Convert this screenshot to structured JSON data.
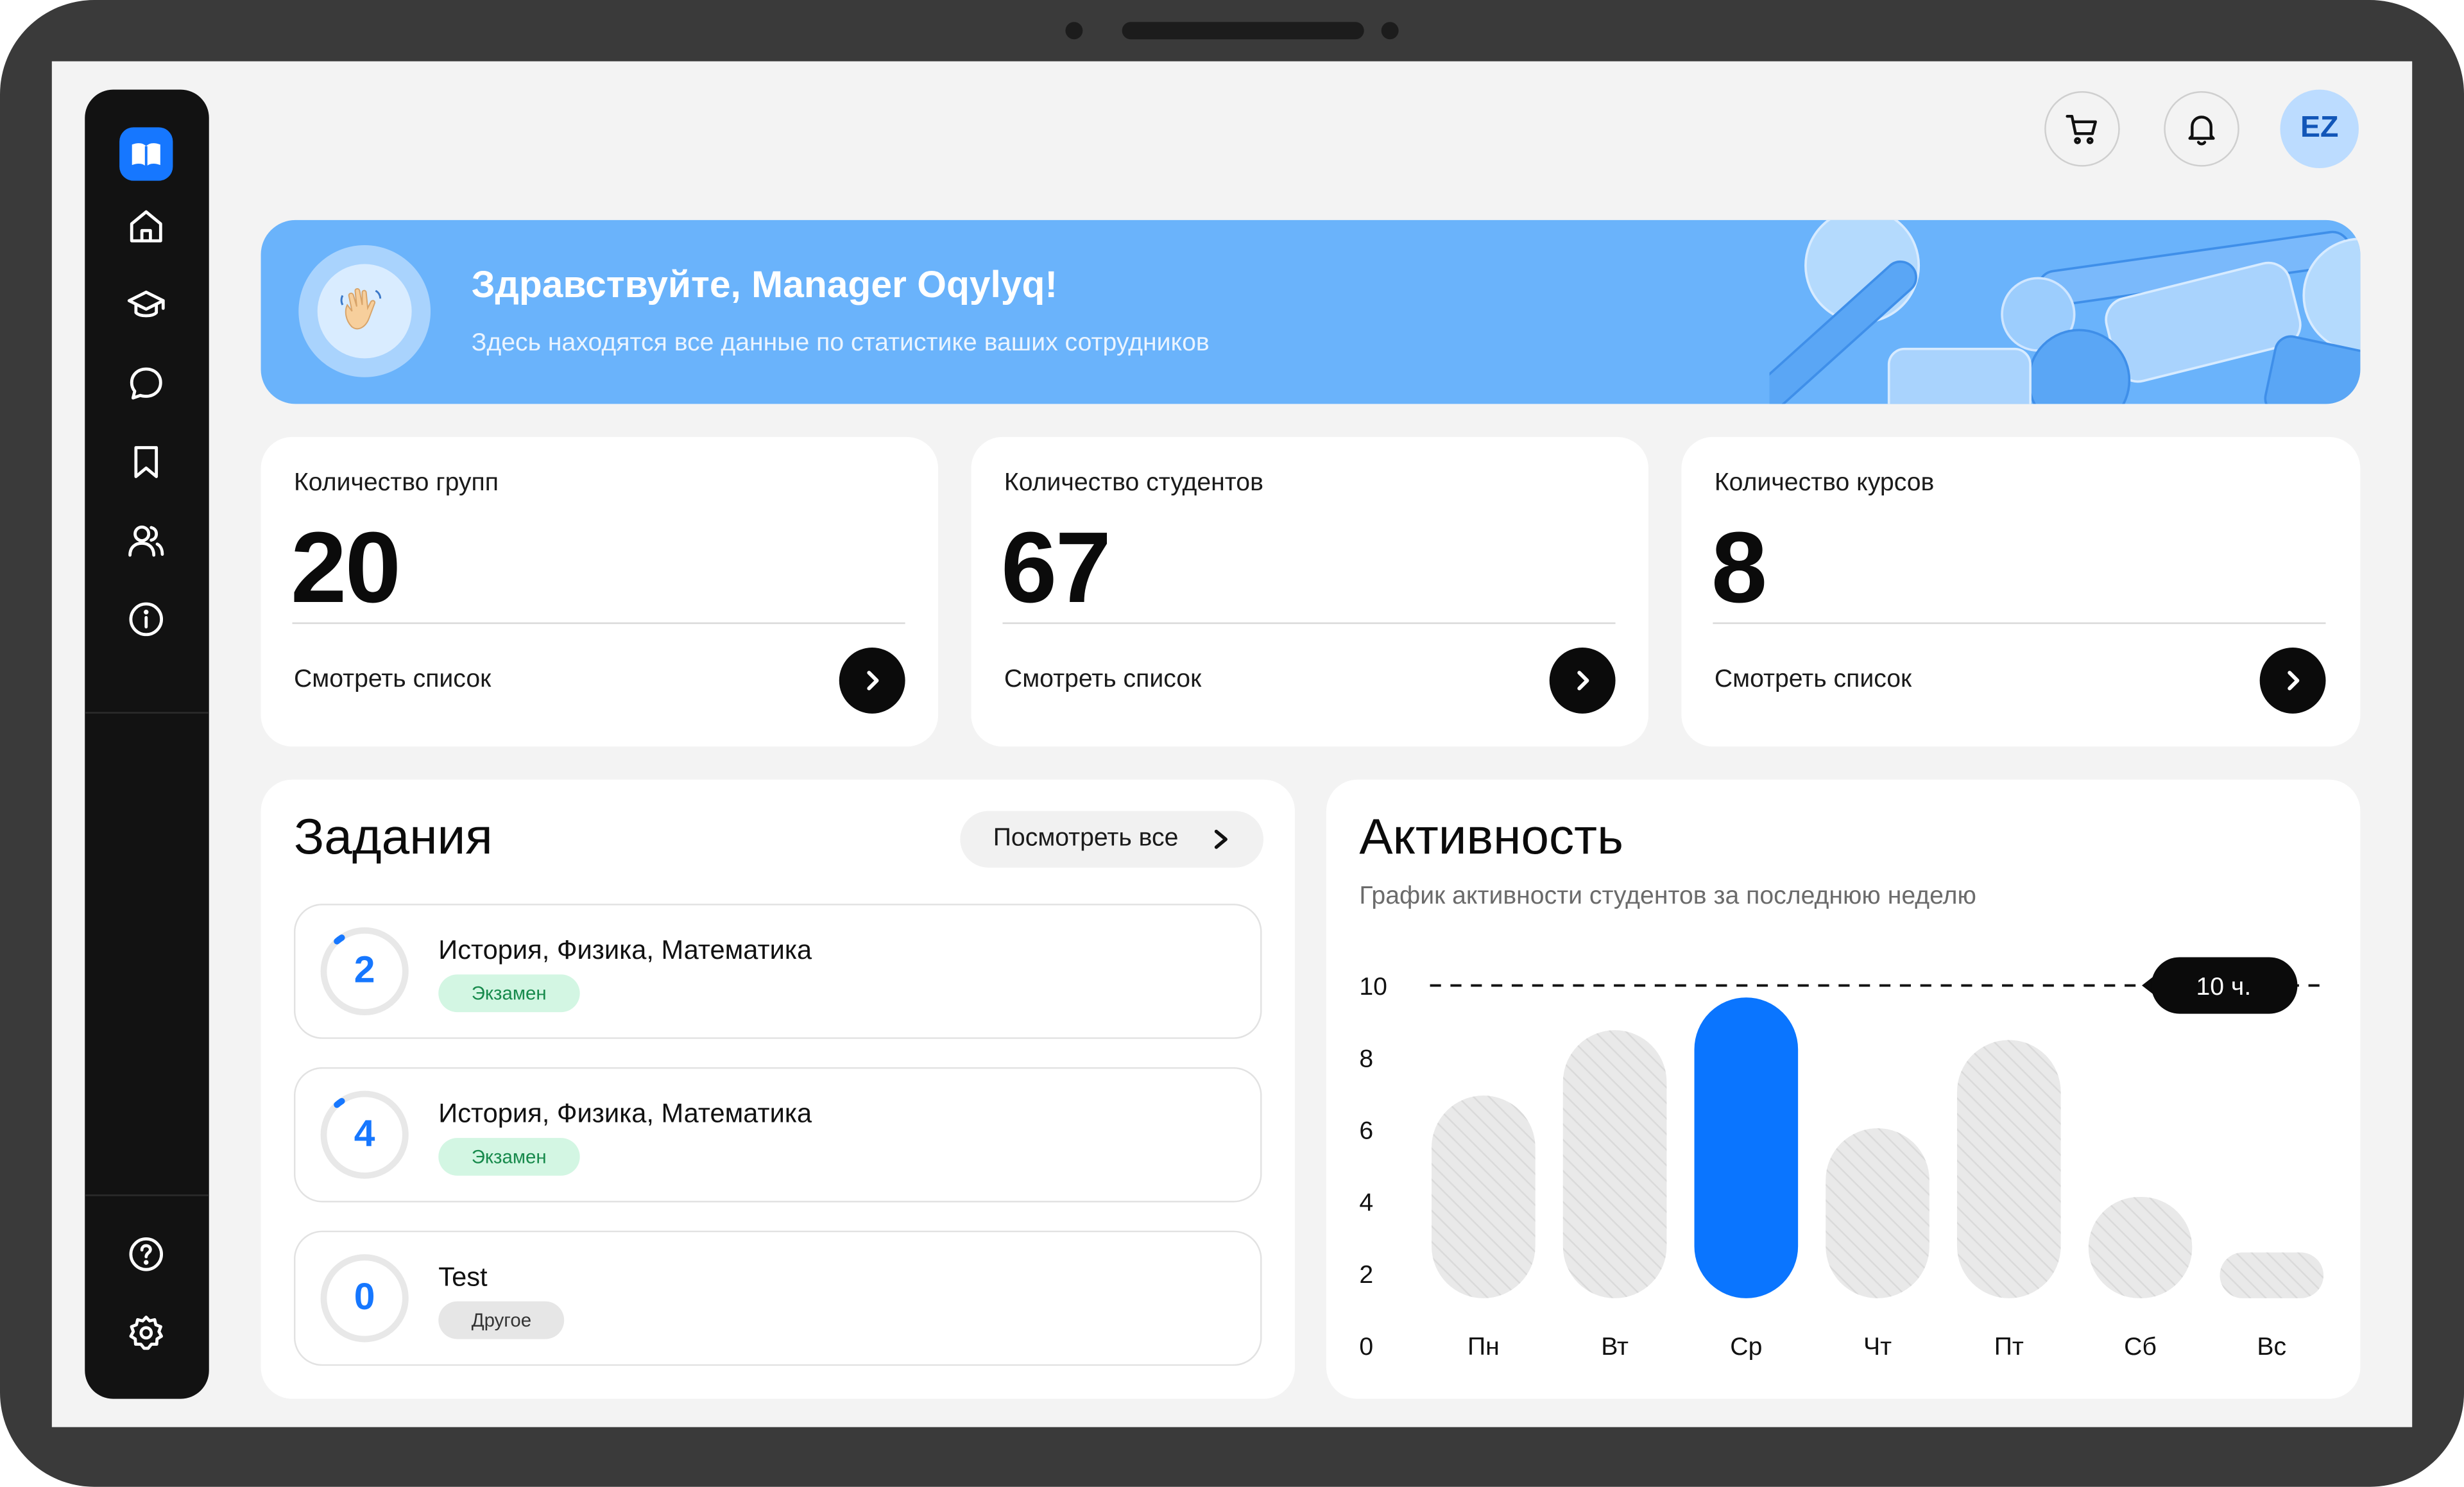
{
  "topbar": {
    "avatar_initials": "EZ",
    "cart_icon": "cart-icon",
    "bell_icon": "bell-icon"
  },
  "sidebar": {
    "items": [
      {
        "icon": "home-icon"
      },
      {
        "icon": "graduation-cap-icon"
      },
      {
        "icon": "chat-icon"
      },
      {
        "icon": "bookmark-icon"
      },
      {
        "icon": "users-icon"
      },
      {
        "icon": "info-icon"
      }
    ],
    "bottom": [
      {
        "icon": "help-icon"
      },
      {
        "icon": "settings-icon"
      }
    ]
  },
  "banner": {
    "title": "Здравствуйте, Manager Oqylyq!",
    "subtitle": "Здесь находятся все данные по статистике ваших сотрудников",
    "icon": "waving-hand-icon"
  },
  "stats": [
    {
      "label": "Количество групп",
      "value": "20",
      "link": "Смотреть список"
    },
    {
      "label": "Количество студентов",
      "value": "67",
      "link": "Смотреть список"
    },
    {
      "label": "Количество курсов",
      "value": "8",
      "link": "Смотреть список"
    }
  ],
  "tasks": {
    "title": "Задания",
    "see_all": "Посмотреть все",
    "items": [
      {
        "count": "2",
        "title": "История, Физика, Математика",
        "tag": "Экзамен",
        "tag_type": "exam"
      },
      {
        "count": "4",
        "title": "История, Физика, Математика",
        "tag": "Экзамен",
        "tag_type": "exam"
      },
      {
        "count": "0",
        "title": "Test",
        "tag": "Другое",
        "tag_type": "other"
      }
    ]
  },
  "activity": {
    "title": "Активность",
    "subtitle": "График активности студентов за последнюю неделю"
  },
  "chart_data": {
    "type": "bar",
    "categories": [
      "Пн",
      "Вт",
      "Ср",
      "Чт",
      "Пт",
      "Сб",
      "Вс"
    ],
    "values": [
      6.2,
      8.2,
      9.2,
      5.2,
      7.9,
      3.1,
      1.4
    ],
    "highlight_index": 2,
    "highlight_color": "#0a75ff",
    "bar_color": "#e9e9e9",
    "ylim": [
      0,
      10
    ],
    "yticks": [
      "0",
      "2",
      "4",
      "6",
      "8",
      "10"
    ],
    "reference_line": {
      "value": 10,
      "label": "10 ч."
    },
    "grid": false
  },
  "colors": {
    "accent": "#1677ff",
    "banner": "#6ab3fb",
    "sidebar": "#121212"
  }
}
